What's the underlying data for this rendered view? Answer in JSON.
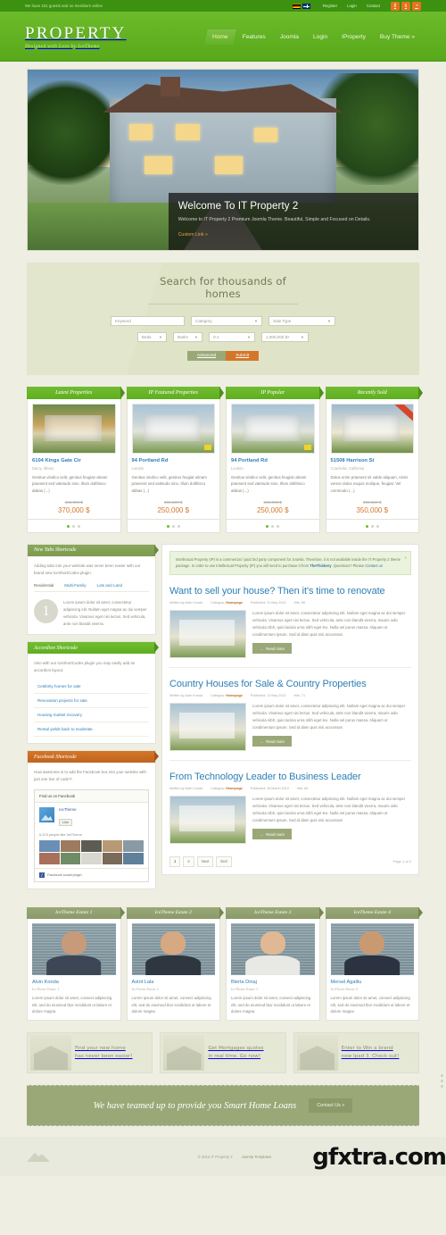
{
  "topbar": {
    "status": "We have 431 guests and no members online",
    "links": [
      "Register",
      "Login",
      "Contact"
    ],
    "flags": [
      "de-flag",
      "gb-flag"
    ],
    "social": [
      {
        "name": "facebook-icon",
        "glyph": "f"
      },
      {
        "name": "twitter-icon",
        "glyph": "t"
      },
      {
        "name": "rss-icon",
        "glyph": "◔"
      }
    ]
  },
  "header": {
    "logo": "PROPERTY",
    "tagline": "Designed with Love by IceTheme",
    "nav": [
      {
        "label": "Home",
        "active": true
      },
      {
        "label": "Features",
        "active": false
      },
      {
        "label": "Joomla",
        "active": false
      },
      {
        "label": "Login",
        "active": false
      },
      {
        "label": "IProperty",
        "active": false
      },
      {
        "label": "Buy Theme »",
        "active": false
      }
    ]
  },
  "hero": {
    "title": "Welcome To IT Property 2",
    "desc": "Welcome to IT Property 2 Premium Joomla Theme. Beautiful, Simple and Focused on Details.",
    "link": "Custom Link »"
  },
  "search": {
    "title": "Search for thousands of homes",
    "keyword_placeholder": "Keyword",
    "category": "Category",
    "sale_type": "Sale Type",
    "beds": "Beds",
    "baths": "Baths",
    "size": "0-1",
    "price": "1,000,000 $+",
    "advanced": "Advanced",
    "submit": "Submit"
  },
  "property_modules": [
    {
      "heading": "Latest Properties",
      "title": "6104 Kings Gate Cir",
      "location": "Darcy, Illinois",
      "desc": "Genitus vindico velit, genitus feugiat utinam praesent sed valetudo sino. Illum dolthisco abbas (...)",
      "old_price": "460,000 $",
      "new_price": "370,000 $",
      "badge": "none",
      "dots": 3,
      "active_dot": 0
    },
    {
      "heading": "IP Featured Properties",
      "title": "94 Portland Rd",
      "location": "London",
      "desc": "Genitus vindico velit, genitus feugiat utinam praesent sed valetudo sino. Illum dolthisco abbas (...)",
      "old_price": "390,000 $",
      "new_price": "250,000 $",
      "badge": "yellow",
      "dots": 3,
      "active_dot": 0
    },
    {
      "heading": "IP Popular",
      "title": "94 Portland Rd",
      "location": "London",
      "desc": "Genitus vindico velit, genitus feugiat utinam praesent sed valetudo sino. Illum dolthisco abbas (...)",
      "old_price": "390,000 $",
      "new_price": "250,000 $",
      "badge": "yellow",
      "dots": 3,
      "active_dot": 0
    },
    {
      "heading": "Recently Sold",
      "title": "51508 Harrison St",
      "location": "Coachella, California",
      "desc": "Dolus enim praesent sit valde aliquam, nimis vereor dolus esquis molique, feugiat. Vel commodo (...)",
      "old_price": "390,000 $",
      "new_price": "350,000 $",
      "badge": "sold",
      "dots": 3,
      "active_dot": 0
    }
  ],
  "sidebar": {
    "tabs_module": {
      "heading": "New Tabs Shortcode",
      "intro": "Adding tabs into your website was never been easier with our brand new IceShortCodes plugin.",
      "tabs": [
        "Residential",
        "Multi-Family",
        "Lots and Land"
      ],
      "active_tab": "Residential",
      "circle_number": "1",
      "tab_text": "Lorem ipsum dolor sit amet, consectetur adipiscing elit. Nullam eget magna ac dui semper vehicula. Vivamus eget nisi lectus. Sed vehicula, ante non blandit viverra."
    },
    "accordion_module": {
      "heading": "Accordion Shortcode",
      "intro": "Also with our IceShortCodes plugin you may easily add an accordion layout.",
      "items": [
        "Celebrity homes for sale",
        "Renovation projects for sale",
        "Housing market recovery",
        "Rental yields back to moderate"
      ]
    },
    "facebook_module": {
      "heading": "Facebook Shortcode",
      "intro": "How awesome is to add the Facebook box into your website with just one line of code?!",
      "box_header": "Find us on Facebook",
      "page_name": "IceTheme",
      "like_button": "Like",
      "people_count": "6,223 people like IceTheme.",
      "footer": "Facebook social plugin"
    }
  },
  "notice": {
    "text_1": "Intellectual Property (IP) is a commercial / paid 3rd party component for Joomla. Therefore, it is not available inside the IT Property 2 theme package. In order to use Intellectual Property (IP) you will need to purchase it from ",
    "vendor": "TheThinkery",
    "text_2": ". Questions? Please ",
    "contact": "Contact us",
    "close": "×"
  },
  "articles": [
    {
      "title": "Want to sell your house? Then it's time to renovate",
      "author": "Written by Alvin Konda",
      "category_label": "Category:",
      "category": "Homepage",
      "published": "Published: 23 May 2013",
      "hits": "Hits: 85",
      "body": "Lorem ipsum dolor sit amet, consectetur adipiscing elit. Nullam eget magna ac dui semper vehicula. Vivamus eget nisi lectus. Sed vehicula, ante non blandit viverra, mauris odio vehicula nibh, quis lacinia urna nibh eget leo. Nulla vel purus massa. Aliquam ut condimentum ipsum. Sed id diam quis nisi accumsan",
      "readmore": "Read more"
    },
    {
      "title": "Country Houses for Sale & Country Properties",
      "author": "Written by Alvin Konda",
      "category_label": "Category:",
      "category": "Homepage",
      "published": "Published: 13 May 2013",
      "hits": "Hits: 71",
      "body": "Lorem ipsum dolor sit amet, consectetur adipiscing elit. Nullam eget magna ac dui semper vehicula. Vivamus eget nisi lectus. Sed vehicula, ante non blandit viverra, mauris odio vehicula nibh, quis lacinia urna nibh eget leo. Nulla vel purus massa. Aliquam ut condimentum ipsum. Sed id diam quis nisi accumsan",
      "readmore": "Read more"
    },
    {
      "title": "From Technology Leader to Business Leader",
      "author": "Written by Alvin Konda",
      "category_label": "Category:",
      "category": "Homepage",
      "published": "Published: 26 March 2013",
      "hits": "Hits: 68",
      "body": "Lorem ipsum dolor sit amet, consectetur adipiscing elit. Nullam eget magna ac dui semper vehicula. Vivamus eget nisi lectus. Sed vehicula, ante non blandit viverra, mauris odio vehicula nibh, quis lacinia urna nibh eget leo. Nulla vel purus massa. Aliquam ut condimentum ipsum. Sed id diam quis nisi accumsan",
      "readmore": "Read more"
    }
  ],
  "pagination": {
    "pages": [
      "1",
      "2",
      "Next",
      "End"
    ],
    "current": "1",
    "count": "Page 1 of 2"
  },
  "team": [
    {
      "heading": "IceTheme Estate 1",
      "name": "Alvin Konda",
      "role": "IceTheme Estate 1",
      "desc": "Lorem ipsum dolor sit amet, consect adipiscing elit, sed do eiusmod tbor incididunt ut labore et dolore magna",
      "skin": "#c79a79",
      "shirt": "#3d4654"
    },
    {
      "heading": "IceTheme Estate 2",
      "name": "Astrit Lala",
      "role": "IceTheme Estate 2",
      "desc": "Lorem ipsum dolor sit amet, consect adipiscing elit, sed do eiusmod tbor incididunt ut labore et dolore magna",
      "skin": "#d6a983",
      "shirt": "#2e3640"
    },
    {
      "heading": "IceTheme Estate 3",
      "name": "Blerta Dinaj",
      "role": "IceTheme Estate 3",
      "desc": "Lorem ipsum dolor sit amet, consect adipiscing elit, sed do eiusmod tbor incididunt ut labore et dolore magna",
      "skin": "#e0b894",
      "shirt": "#e8e8e4"
    },
    {
      "heading": "IceTheme Estate 4",
      "name": "Mersel Agalliu",
      "role": "IceTheme Estate 4",
      "desc": "Lorem ipsum dolor sit amet, consect adipiscing elit, sed do eiusmod tbor incididunt ut labore et dolore magna",
      "skin": "#c99a72",
      "shirt": "#2b3340"
    }
  ],
  "banners": [
    {
      "line1": "Find your new home",
      "line2": "has never been easier!"
    },
    {
      "line1": "Get Mortgages quotes",
      "line2": "in real time. Go now!"
    },
    {
      "line1": "Enter to Win a brand",
      "line2": "new Ipad 3. Check out!"
    }
  ],
  "cta": {
    "text": "We have teamed up to provide you Smart Home Loans",
    "button": "Contact Us »"
  },
  "footer": {
    "copyright": "© 2013 IT Property 2",
    "link": "Joomla Templates",
    "watermark": "gfxtra.com"
  }
}
